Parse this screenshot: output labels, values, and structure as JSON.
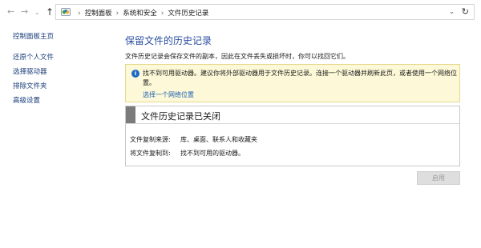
{
  "address_bar": {
    "back_icon": "arrow-left-icon",
    "forward_icon": "arrow-right-icon",
    "recent_icon": "chevron-down-icon",
    "up_icon": "arrow-up-icon",
    "location_icon": "control-panel-icon",
    "breadcrumb": [
      "控制面板",
      "系统和安全",
      "文件历史记录"
    ],
    "refresh_icon": "refresh-icon"
  },
  "sidebar": {
    "home_link": "控制面板主页",
    "items": [
      {
        "label": "还原个人文件"
      },
      {
        "label": "选择驱动器"
      },
      {
        "label": "排除文件夹"
      },
      {
        "label": "高级设置"
      }
    ]
  },
  "main": {
    "title": "保留文件的历史记录",
    "description": "文件历史记录会保存文件的副本，因此在文件丢失或损坏时，你可以找回它们。",
    "warning": {
      "icon": "info-icon",
      "text": "找不到可用驱动器。建议你将外部驱动器用于文件历史记录。连接一个驱动器并刷新此页，或者使用一个网络位置。",
      "link": "选择一个网络位置"
    },
    "status": {
      "title": "文件历史记录已关闭",
      "copy_from_label": "文件复制来源:",
      "copy_from_value": "库、桌面、联系人和收藏夹",
      "copy_to_label": "将文件复制到:",
      "copy_to_value": "找不到可用的驱动器。"
    },
    "enable_button": "启用"
  }
}
